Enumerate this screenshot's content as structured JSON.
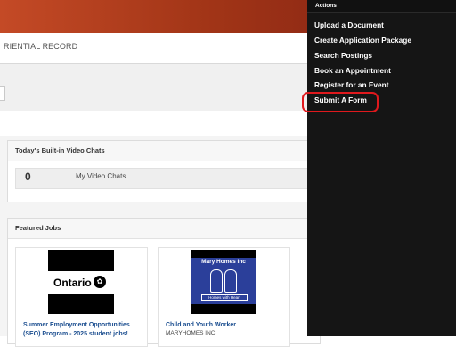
{
  "header": {
    "page_title": "RIENTIAL RECORD"
  },
  "video_chats": {
    "title": "Today's Built-in Video Chats",
    "count": "0",
    "label": "My Video Chats"
  },
  "featured_jobs": {
    "title": "Featured Jobs",
    "cards": [
      {
        "logo_text": "Ontario",
        "title": "Summer Employment Opportunities (SEO) Program - 2025 student jobs!",
        "company": ""
      },
      {
        "logo_text": "Mary Homes Inc",
        "logo_subtext": "Homes with Heart",
        "title": "Child and Youth Worker",
        "company": "MARYHOMES INC."
      }
    ]
  },
  "sidebar": {
    "title": "Actions",
    "items": [
      "Upload a Document",
      "Create Application Package",
      "Search Postings",
      "Book an Appointment",
      "Register for an Event",
      "Submit A Form"
    ]
  },
  "colors": {
    "header_gradient_start": "#c44a26",
    "header_gradient_end": "#7e1f12",
    "sidebar_bg": "#151515",
    "link_blue": "#1a4d8f",
    "highlight_red": "#e0191d"
  }
}
